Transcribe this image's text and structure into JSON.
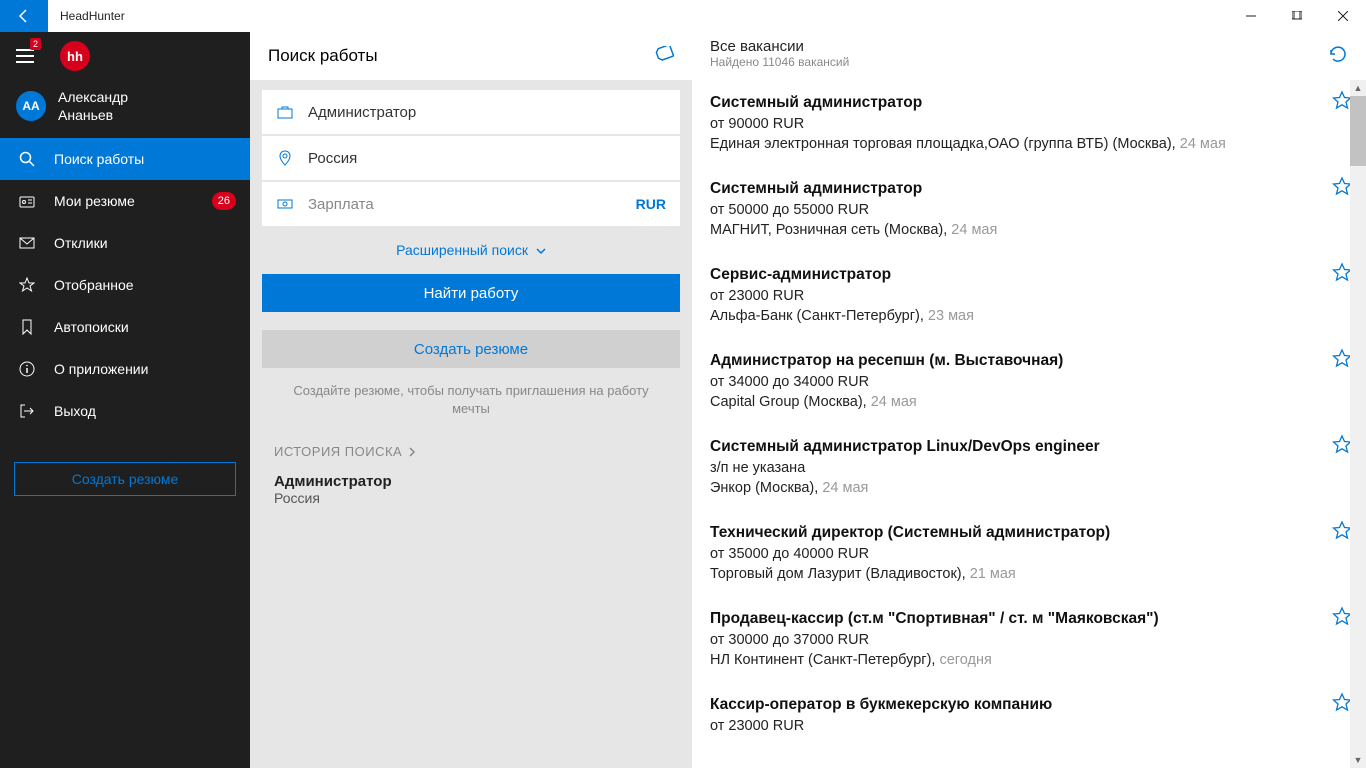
{
  "window": {
    "title": "HeadHunter"
  },
  "sidebar": {
    "logo_text": "hh",
    "top_badge": "2",
    "user": {
      "initials": "АА",
      "name_line1": "Александр",
      "name_line2": "Ананьев"
    },
    "items": [
      {
        "label": "Поиск работы"
      },
      {
        "label": "Мои резюме",
        "badge": "26"
      },
      {
        "label": "Отклики"
      },
      {
        "label": "Отобранное"
      },
      {
        "label": "Автопоиски"
      },
      {
        "label": "О приложении"
      },
      {
        "label": "Выход"
      }
    ],
    "create_btn": "Создать резюме"
  },
  "search": {
    "title": "Поиск работы",
    "query_value": "Администратор",
    "region_value": "Россия",
    "salary_placeholder": "Зарплата",
    "currency": "RUR",
    "advanced": "Расширенный поиск",
    "find_btn": "Найти работу",
    "create_resume_btn": "Создать резюме",
    "hint": "Создайте резюме, чтобы получать приглашения на работу мечты",
    "history_label": "ИСТОРИЯ ПОИСКА",
    "history": {
      "title": "Администратор",
      "region": "Россия"
    }
  },
  "results": {
    "title": "Все вакансии",
    "count_text": "Найдено 11046 вакансий",
    "items": [
      {
        "title": "Системный администратор",
        "salary": "от 90000 RUR",
        "company": "Единая электронная торговая площадка,ОАО (группа ВТБ) (Москва), ",
        "date": "24 мая"
      },
      {
        "title": "Системный администратор",
        "salary": "от 50000 до 55000 RUR",
        "company": "МАГНИТ, Розничная сеть (Москва), ",
        "date": "24 мая"
      },
      {
        "title": "Сервис-администратор",
        "salary": "от 23000 RUR",
        "company": "Альфа-Банк (Санкт-Петербург), ",
        "date": "23 мая"
      },
      {
        "title": "Администратор на ресепшн (м. Выставочная)",
        "salary": "от 34000 до 34000 RUR",
        "company": "Capital Group (Москва), ",
        "date": "24 мая"
      },
      {
        "title": "Системный администратор Linux/DevOps engineer",
        "salary": "з/п не указана",
        "company": "Энкор (Москва), ",
        "date": "24 мая"
      },
      {
        "title": "Технический директор (Системный администратор)",
        "salary": "от 35000 до 40000 RUR",
        "company": "Торговый дом Лазурит (Владивосток), ",
        "date": "21 мая"
      },
      {
        "title": "Продавец-кассир (ст.м \"Спортивная\" / ст. м \"Маяковская\")",
        "salary": "от 30000 до 37000 RUR",
        "company": "НЛ Континент (Санкт-Петербург), ",
        "date": "сегодня"
      },
      {
        "title": "Кассир-оператор в букмекерскую компанию",
        "salary": "от 23000 RUR",
        "company": "",
        "date": ""
      }
    ]
  }
}
